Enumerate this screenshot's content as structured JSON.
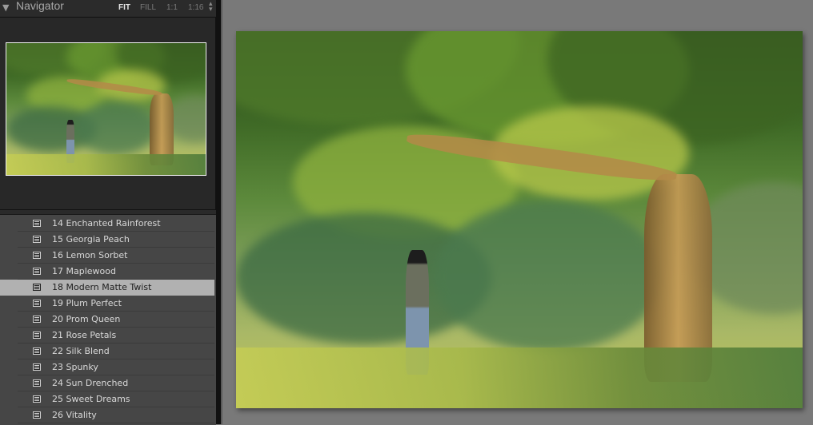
{
  "navigator": {
    "title": "Navigator",
    "collapse_icon": "triangle-down-icon",
    "zoom_options": [
      "FIT",
      "FILL",
      "1:1",
      "1:16"
    ],
    "active_zoom": "FIT",
    "stepper_icon": "up-down-stepper-icon",
    "thumbnail_alt": "Woman in hat walking under large tree"
  },
  "presets": {
    "icon": "preset-list-icon",
    "selected": "18 Modern Matte Twist",
    "items": [
      {
        "label": "14 Enchanted Rainforest",
        "selected": false
      },
      {
        "label": "15 Georgia Peach",
        "selected": false
      },
      {
        "label": "16 Lemon Sorbet",
        "selected": false
      },
      {
        "label": "17 Maplewood",
        "selected": false
      },
      {
        "label": "18 Modern Matte Twist",
        "selected": true
      },
      {
        "label": "19 Plum Perfect",
        "selected": false
      },
      {
        "label": "20 Prom Queen",
        "selected": false
      },
      {
        "label": "21 Rose Petals",
        "selected": false
      },
      {
        "label": "22 Silk Blend",
        "selected": false
      },
      {
        "label": "23 Spunky",
        "selected": false
      },
      {
        "label": "24 Sun Drenched",
        "selected": false
      },
      {
        "label": "25 Sweet Dreams",
        "selected": false
      },
      {
        "label": "26 Vitality",
        "selected": false
      }
    ]
  },
  "main_image": {
    "description": "Woman in black hat walking under a large sunlit tree in a park"
  },
  "colors": {
    "panel_bg": "#2a2a2a",
    "list_bg": "#464646",
    "selected_row": "#b1b1b1",
    "canvas_bg": "#797979"
  }
}
